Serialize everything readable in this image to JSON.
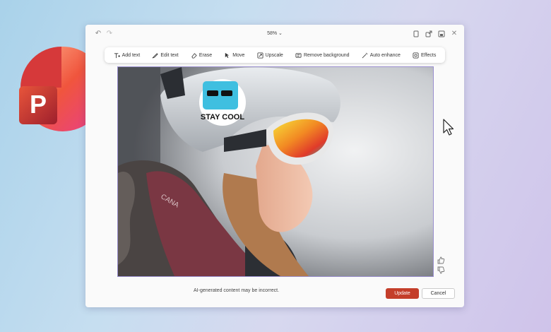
{
  "app": {
    "name": "PowerPoint",
    "logo_letter": "P",
    "colors": {
      "brand": "#c43e2a",
      "logo_light": "#f7a28a",
      "logo_dark": "#b3262e"
    }
  },
  "titlebar": {
    "zoom_label": "58%",
    "icons": [
      "undo-icon",
      "redo-icon",
      "copy-icon",
      "share-icon",
      "save-icon",
      "close-icon"
    ]
  },
  "toolbar": {
    "items": [
      {
        "label": "Add text",
        "icon": "add-text-icon"
      },
      {
        "label": "Edit text",
        "icon": "edit-text-icon"
      },
      {
        "label": "Erase",
        "icon": "erase-icon"
      },
      {
        "label": "Move",
        "icon": "move-icon"
      },
      {
        "label": "Upscale",
        "icon": "upscale-icon"
      },
      {
        "label": "Remove background",
        "icon": "remove-background-icon"
      },
      {
        "label": "Auto enhance",
        "icon": "auto-enhance-icon"
      },
      {
        "label": "Effects",
        "icon": "effects-icon"
      }
    ]
  },
  "image": {
    "sticker_text": "STAY COOL",
    "jacket_text": "CANA"
  },
  "feedback": {
    "icons": [
      "thumbs-up-icon",
      "thumbs-down-icon"
    ]
  },
  "footer": {
    "disclaimer": "AI-generated content may be incorrect.",
    "update_label": "Update",
    "cancel_label": "Cancel"
  }
}
